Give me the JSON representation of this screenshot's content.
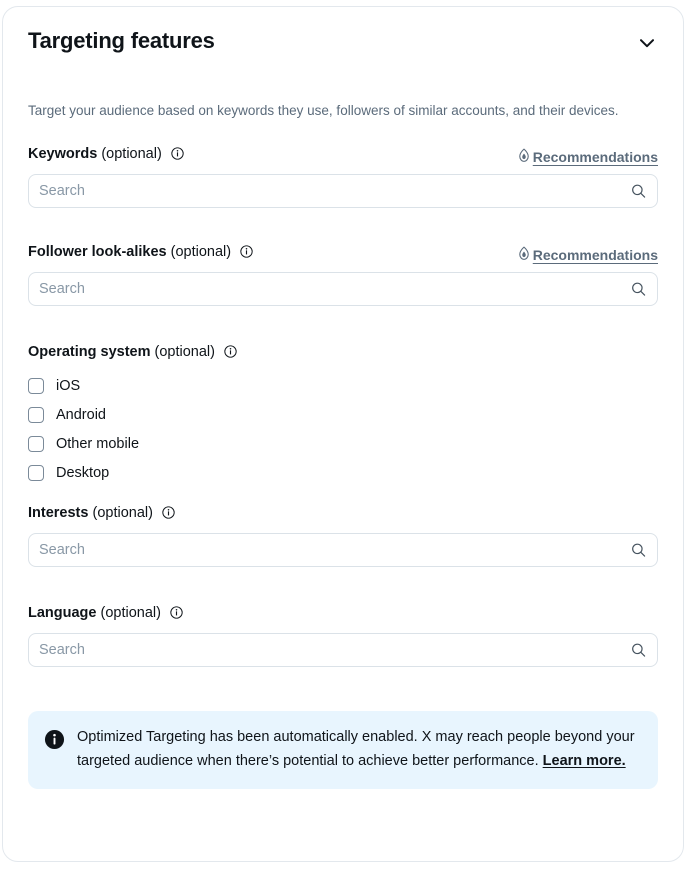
{
  "card": {
    "title": "Targeting features",
    "collapse_icon": "chevron-down-icon",
    "description": "Target your audience based on keywords they use, followers of similar accounts, and their devices."
  },
  "fields": {
    "keywords": {
      "label": "Keywords",
      "optional": "(optional)",
      "info_icon": "info-circle-icon",
      "recommendations_label": "Recommendations",
      "recommendations_icon": "flame-icon",
      "search_placeholder": "Search",
      "search_value": "",
      "search_icon": "search-icon"
    },
    "follower_lookalikes": {
      "label": "Follower look-alikes",
      "optional": "(optional)",
      "info_icon": "info-circle-icon",
      "recommendations_label": "Recommendations",
      "recommendations_icon": "flame-icon",
      "search_placeholder": "Search",
      "search_value": "",
      "search_icon": "search-icon"
    },
    "operating_system": {
      "label": "Operating system",
      "optional": "(optional)",
      "info_icon": "info-circle-icon",
      "options": [
        {
          "label": "iOS",
          "checked": false
        },
        {
          "label": "Android",
          "checked": false
        },
        {
          "label": "Other mobile",
          "checked": false
        },
        {
          "label": "Desktop",
          "checked": false
        }
      ]
    },
    "interests": {
      "label": "Interests",
      "optional": "(optional)",
      "info_icon": "info-circle-icon",
      "search_placeholder": "Search",
      "search_value": "",
      "search_icon": "search-icon"
    },
    "language": {
      "label": "Language",
      "optional": "(optional)",
      "info_icon": "info-circle-icon",
      "search_placeholder": "Search",
      "search_value": "",
      "search_icon": "search-icon"
    }
  },
  "notice": {
    "icon": "info-filled-icon",
    "text": "Optimized Targeting has been automatically enabled. X may reach people beyond your targeted audience when there’s potential to achieve better performance.",
    "link_label": "Learn more.",
    "background_color": "#e8f5fe"
  },
  "colors": {
    "text_primary": "#0f1419",
    "text_secondary": "#5b6b7b",
    "border": "#dbe2e8",
    "card_border": "#e3e8ed",
    "placeholder": "#8998a6"
  }
}
